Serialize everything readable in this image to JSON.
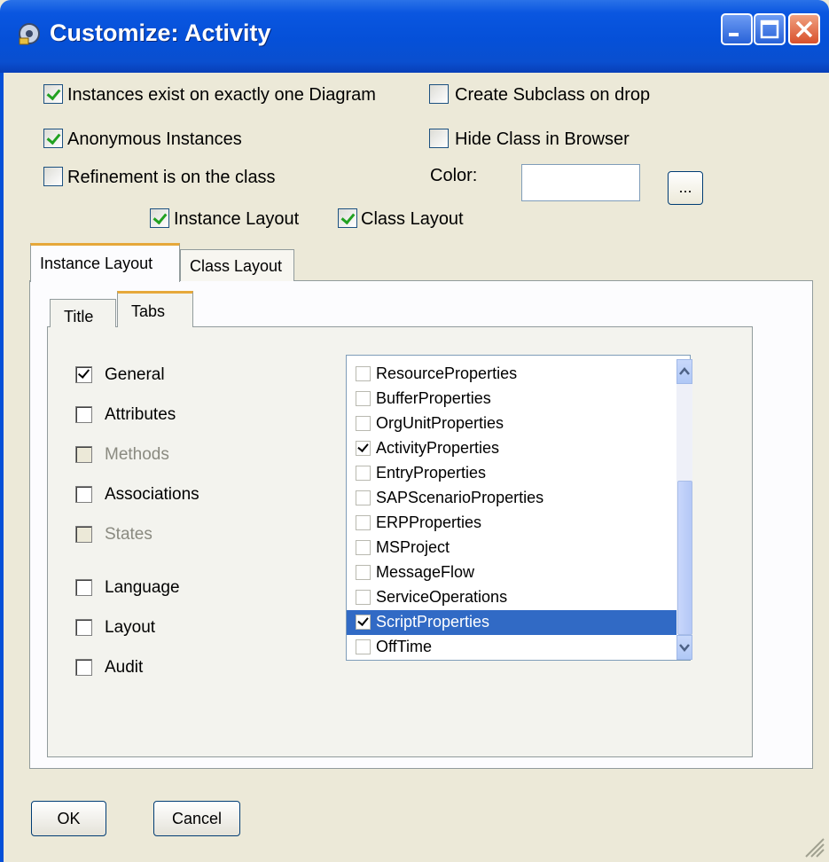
{
  "window": {
    "title": "Customize: Activity"
  },
  "options": {
    "instances_one_diagram": {
      "label": "Instances exist on exactly one Diagram",
      "checked": true
    },
    "anonymous_instances": {
      "label": "Anonymous Instances",
      "checked": true
    },
    "refinement_on_class": {
      "label": "Refinement is on the class",
      "checked": false
    },
    "create_subclass_on_drop": {
      "label": "Create Subclass on drop",
      "checked": false
    },
    "hide_class_in_browser": {
      "label": "Hide Class in Browser",
      "checked": false
    },
    "color_label": "Color:",
    "color_value": "",
    "color_picker_label": "...",
    "instance_layout": {
      "label": "Instance Layout",
      "checked": true
    },
    "class_layout": {
      "label": "Class Layout",
      "checked": true
    }
  },
  "outer_tabs": [
    {
      "label": "Instance Layout",
      "active": true
    },
    {
      "label": "Class Layout",
      "active": false
    }
  ],
  "inner_tabs": [
    {
      "label": "Title",
      "active": false
    },
    {
      "label": "Tabs",
      "active": true
    }
  ],
  "tab_checks": [
    {
      "label": "General",
      "checked": true,
      "enabled": true
    },
    {
      "label": "Attributes",
      "checked": false,
      "enabled": true
    },
    {
      "label": "Methods",
      "checked": false,
      "enabled": false
    },
    {
      "label": "Associations",
      "checked": false,
      "enabled": true
    },
    {
      "label": "States",
      "checked": false,
      "enabled": false
    },
    {
      "label": "Language",
      "checked": false,
      "enabled": true
    },
    {
      "label": "Layout",
      "checked": false,
      "enabled": true
    },
    {
      "label": "Audit",
      "checked": false,
      "enabled": true
    }
  ],
  "property_list": [
    {
      "label": "ResourceProperties",
      "checked": false,
      "selected": false
    },
    {
      "label": "BufferProperties",
      "checked": false,
      "selected": false
    },
    {
      "label": "OrgUnitProperties",
      "checked": false,
      "selected": false
    },
    {
      "label": "ActivityProperties",
      "checked": true,
      "selected": false
    },
    {
      "label": "EntryProperties",
      "checked": false,
      "selected": false
    },
    {
      "label": "SAPScenarioProperties",
      "checked": false,
      "selected": false
    },
    {
      "label": "ERPProperties",
      "checked": false,
      "selected": false
    },
    {
      "label": "MSProject",
      "checked": false,
      "selected": false
    },
    {
      "label": "MessageFlow",
      "checked": false,
      "selected": false
    },
    {
      "label": "ServiceOperations",
      "checked": false,
      "selected": false
    },
    {
      "label": "ScriptProperties",
      "checked": true,
      "selected": true
    },
    {
      "label": "OffTime",
      "checked": false,
      "selected": false
    }
  ],
  "buttons": {
    "ok": "OK",
    "cancel": "Cancel"
  },
  "colors": {
    "titlebar": "#0550d8",
    "dialog_bg": "#ece9d8",
    "selection": "#316ac5",
    "tab_highlight": "#e6a83a"
  }
}
